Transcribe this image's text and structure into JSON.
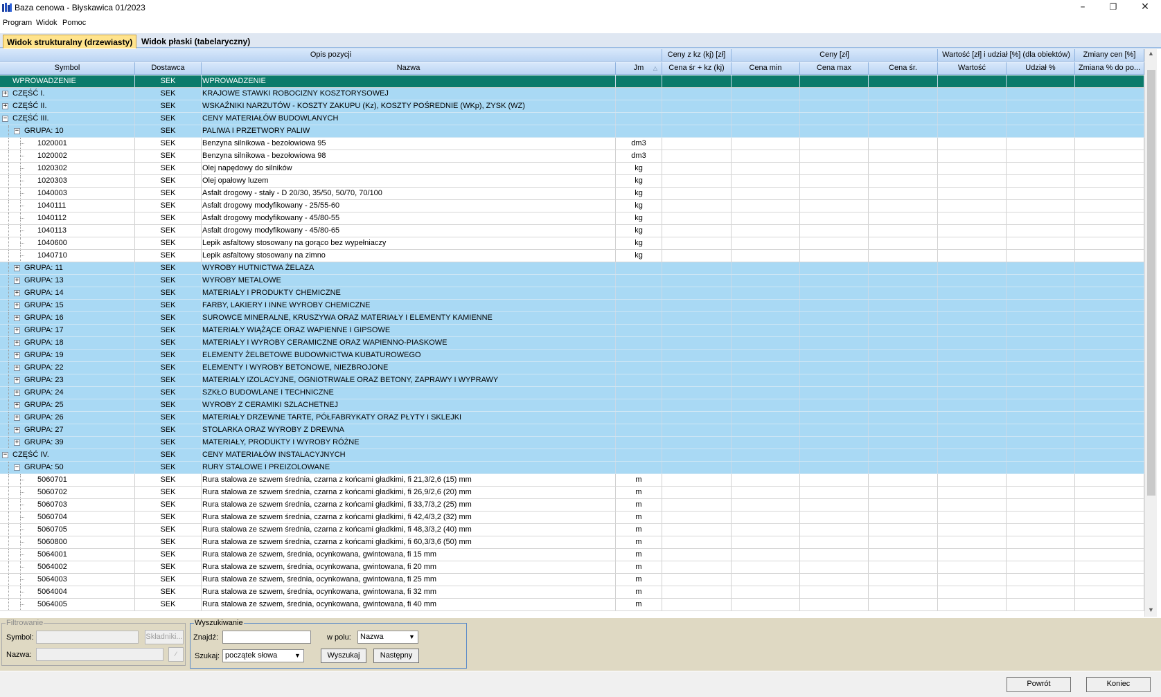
{
  "window": {
    "title": "Baza cenowa - Błyskawica 01/2023",
    "minimize_icon": "minimize-icon",
    "maximize_icon": "maximize-icon",
    "close_icon": "close-icon"
  },
  "menu": [
    "Program",
    "Widok",
    "Pomoc"
  ],
  "tabs": [
    "Widok strukturalny (drzewiasty)",
    "Widok płaski (tabelaryczny)"
  ],
  "header_groups": {
    "opis": "Opis pozycji",
    "kz": "Ceny z kz (kj) [zł]",
    "ceny": "Ceny [zł]",
    "wartosc": "Wartość [zł] i udział [%] (dla obiektów)",
    "zmiany": "Zmiany cen [%]"
  },
  "columns": {
    "symbol": "Symbol",
    "dostawca": "Dostawca",
    "nazwa": "Nazwa",
    "jm": "Jm",
    "cena_kz": "Cena śr + kz (kj)",
    "cena_min": "Cena min",
    "cena_max": "Cena max",
    "cena_sr": "Cena śr.",
    "wartosc": "Wartość",
    "udzial": "Udział %",
    "zmiana": "Zmiana % do po..."
  },
  "rows": [
    {
      "level": 0,
      "type": "selected",
      "exp": "",
      "symbol": "WPROWADZENIE",
      "dostawca": "SEK",
      "nazwa": "WPROWADZENIE",
      "jm": ""
    },
    {
      "level": 0,
      "type": "group",
      "exp": "+",
      "symbol": "CZĘŚĆ I.",
      "dostawca": "SEK",
      "nazwa": "KRAJOWE STAWKI ROBOCIZNY KOSZTORYSOWEJ",
      "jm": ""
    },
    {
      "level": 0,
      "type": "group",
      "exp": "+",
      "symbol": "CZĘŚĆ II.",
      "dostawca": "SEK",
      "nazwa": "WSKAŹNIKI NARZUTÓW - KOSZTY ZAKUPU (Kz), KOSZTY POŚREDNIE (WKp), ZYSK (WZ)",
      "jm": ""
    },
    {
      "level": 0,
      "type": "group",
      "exp": "−",
      "symbol": "CZĘŚĆ III.",
      "dostawca": "SEK",
      "nazwa": "CENY MATERIAŁÓW BUDOWLANYCH",
      "jm": ""
    },
    {
      "level": 1,
      "type": "group",
      "exp": "−",
      "symbol": "GRUPA: 10",
      "dostawca": "SEK",
      "nazwa": "PALIWA I PRZETWORY PALIW",
      "jm": ""
    },
    {
      "level": 2,
      "type": "item",
      "exp": "",
      "symbol": "1020001",
      "dostawca": "SEK",
      "nazwa": "Benzyna silnikowa - bezołowiowa 95",
      "jm": "dm3"
    },
    {
      "level": 2,
      "type": "item",
      "exp": "",
      "symbol": "1020002",
      "dostawca": "SEK",
      "nazwa": "Benzyna silnikowa - bezołowiowa 98",
      "jm": "dm3"
    },
    {
      "level": 2,
      "type": "item",
      "exp": "",
      "symbol": "1020302",
      "dostawca": "SEK",
      "nazwa": "Olej napędowy do silników",
      "jm": "kg"
    },
    {
      "level": 2,
      "type": "item",
      "exp": "",
      "symbol": "1020303",
      "dostawca": "SEK",
      "nazwa": "Olej opałowy luzem",
      "jm": "kg"
    },
    {
      "level": 2,
      "type": "item",
      "exp": "",
      "symbol": "1040003",
      "dostawca": "SEK",
      "nazwa": "Asfalt drogowy - stały - D 20/30, 35/50, 50/70, 70/100",
      "jm": "kg"
    },
    {
      "level": 2,
      "type": "item",
      "exp": "",
      "symbol": "1040111",
      "dostawca": "SEK",
      "nazwa": "Asfalt drogowy modyfikowany - 25/55-60",
      "jm": "kg"
    },
    {
      "level": 2,
      "type": "item",
      "exp": "",
      "symbol": "1040112",
      "dostawca": "SEK",
      "nazwa": "Asfalt drogowy modyfikowany - 45/80-55",
      "jm": "kg"
    },
    {
      "level": 2,
      "type": "item",
      "exp": "",
      "symbol": "1040113",
      "dostawca": "SEK",
      "nazwa": "Asfalt drogowy modyfikowany - 45/80-65",
      "jm": "kg"
    },
    {
      "level": 2,
      "type": "item",
      "exp": "",
      "symbol": "1040600",
      "dostawca": "SEK",
      "nazwa": "Lepik asfaltowy stosowany na gorąco bez wypełniaczy",
      "jm": "kg"
    },
    {
      "level": 2,
      "type": "item",
      "exp": "",
      "symbol": "1040710",
      "dostawca": "SEK",
      "nazwa": "Lepik asfaltowy stosowany na zimno",
      "jm": "kg"
    },
    {
      "level": 1,
      "type": "group",
      "exp": "+",
      "symbol": "GRUPA: 11",
      "dostawca": "SEK",
      "nazwa": "WYROBY HUTNICTWA ŻELAZA",
      "jm": ""
    },
    {
      "level": 1,
      "type": "group",
      "exp": "+",
      "symbol": "GRUPA: 13",
      "dostawca": "SEK",
      "nazwa": "WYROBY METALOWE",
      "jm": ""
    },
    {
      "level": 1,
      "type": "group",
      "exp": "+",
      "symbol": "GRUPA: 14",
      "dostawca": "SEK",
      "nazwa": "MATERIAŁY I PRODUKTY CHEMICZNE",
      "jm": ""
    },
    {
      "level": 1,
      "type": "group",
      "exp": "+",
      "symbol": "GRUPA: 15",
      "dostawca": "SEK",
      "nazwa": "FARBY, LAKIERY I INNE WYROBY CHEMICZNE",
      "jm": ""
    },
    {
      "level": 1,
      "type": "group",
      "exp": "+",
      "symbol": "GRUPA: 16",
      "dostawca": "SEK",
      "nazwa": "SUROWCE MINERALNE, KRUSZYWA ORAZ MATERIAŁY I ELEMENTY KAMIENNE",
      "jm": ""
    },
    {
      "level": 1,
      "type": "group",
      "exp": "+",
      "symbol": "GRUPA: 17",
      "dostawca": "SEK",
      "nazwa": "MATERIAŁY WIĄŻĄCE ORAZ WAPIENNE I GIPSOWE",
      "jm": ""
    },
    {
      "level": 1,
      "type": "group",
      "exp": "+",
      "symbol": "GRUPA: 18",
      "dostawca": "SEK",
      "nazwa": "MATERIAŁY I WYROBY CERAMICZNE ORAZ WAPIENNO-PIASKOWE",
      "jm": ""
    },
    {
      "level": 1,
      "type": "group",
      "exp": "+",
      "symbol": "GRUPA: 19",
      "dostawca": "SEK",
      "nazwa": "ELEMENTY ŻELBETOWE BUDOWNICTWA KUBATUROWEGO",
      "jm": ""
    },
    {
      "level": 1,
      "type": "group",
      "exp": "+",
      "symbol": "GRUPA: 22",
      "dostawca": "SEK",
      "nazwa": "ELEMENTY I WYROBY BETONOWE, NIEZBROJONE",
      "jm": ""
    },
    {
      "level": 1,
      "type": "group",
      "exp": "+",
      "symbol": "GRUPA: 23",
      "dostawca": "SEK",
      "nazwa": "MATERIAŁY IZOLACYJNE, OGNIOTRWAŁE ORAZ BETONY, ZAPRAWY I WYPRAWY",
      "jm": ""
    },
    {
      "level": 1,
      "type": "group",
      "exp": "+",
      "symbol": "GRUPA: 24",
      "dostawca": "SEK",
      "nazwa": "SZKŁO BUDOWLANE I TECHNICZNE",
      "jm": ""
    },
    {
      "level": 1,
      "type": "group",
      "exp": "+",
      "symbol": "GRUPA: 25",
      "dostawca": "SEK",
      "nazwa": "WYROBY Z CERAMIKI SZLACHETNEJ",
      "jm": ""
    },
    {
      "level": 1,
      "type": "group",
      "exp": "+",
      "symbol": "GRUPA: 26",
      "dostawca": "SEK",
      "nazwa": "MATERIAŁY DRZEWNE TARTE, PÓŁFABRYKATY ORAZ PŁYTY I SKLEJKI",
      "jm": ""
    },
    {
      "level": 1,
      "type": "group",
      "exp": "+",
      "symbol": "GRUPA: 27",
      "dostawca": "SEK",
      "nazwa": "STOLARKA ORAZ WYROBY Z DREWNA",
      "jm": ""
    },
    {
      "level": 1,
      "type": "group",
      "exp": "+",
      "symbol": "GRUPA: 39",
      "dostawca": "SEK",
      "nazwa": "MATERIAŁY, PRODUKTY I WYROBY RÓŻNE",
      "jm": ""
    },
    {
      "level": 0,
      "type": "group",
      "exp": "−",
      "symbol": "CZĘŚĆ IV.",
      "dostawca": "SEK",
      "nazwa": "CENY MATERIAŁÓW INSTALACYJNYCH",
      "jm": ""
    },
    {
      "level": 1,
      "type": "group",
      "exp": "−",
      "symbol": "GRUPA: 50",
      "dostawca": "SEK",
      "nazwa": "RURY STALOWE I PREIZOLOWANE",
      "jm": ""
    },
    {
      "level": 2,
      "type": "item",
      "exp": "",
      "symbol": "5060701",
      "dostawca": "SEK",
      "nazwa": "Rura stalowa ze szwem średnia, czarna z końcami gładkimi, fi 21,3/2,6 (15) mm",
      "jm": "m"
    },
    {
      "level": 2,
      "type": "item",
      "exp": "",
      "symbol": "5060702",
      "dostawca": "SEK",
      "nazwa": "Rura stalowa ze szwem średnia, czarna z końcami gładkimi, fi 26,9/2,6 (20) mm",
      "jm": "m"
    },
    {
      "level": 2,
      "type": "item",
      "exp": "",
      "symbol": "5060703",
      "dostawca": "SEK",
      "nazwa": "Rura stalowa ze szwem średnia, czarna z końcami gładkimi, fi 33,7/3,2 (25) mm",
      "jm": "m"
    },
    {
      "level": 2,
      "type": "item",
      "exp": "",
      "symbol": "5060704",
      "dostawca": "SEK",
      "nazwa": "Rura stalowa ze szwem średnia, czarna z końcami gładkimi, fi 42,4/3,2 (32) mm",
      "jm": "m"
    },
    {
      "level": 2,
      "type": "item",
      "exp": "",
      "symbol": "5060705",
      "dostawca": "SEK",
      "nazwa": "Rura stalowa ze szwem średnia, czarna z końcami gładkimi, fi 48,3/3,2 (40) mm",
      "jm": "m"
    },
    {
      "level": 2,
      "type": "item",
      "exp": "",
      "symbol": "5060800",
      "dostawca": "SEK",
      "nazwa": "Rura stalowa ze szwem średnia, czarna z końcami gładkimi, fi 60,3/3,6 (50) mm",
      "jm": "m"
    },
    {
      "level": 2,
      "type": "item",
      "exp": "",
      "symbol": "5064001",
      "dostawca": "SEK",
      "nazwa": "Rura stalowa ze szwem, średnia, ocynkowana, gwintowana, fi 15 mm",
      "jm": "m"
    },
    {
      "level": 2,
      "type": "item",
      "exp": "",
      "symbol": "5064002",
      "dostawca": "SEK",
      "nazwa": "Rura stalowa ze szwem, średnia, ocynkowana, gwintowana, fi 20 mm",
      "jm": "m"
    },
    {
      "level": 2,
      "type": "item",
      "exp": "",
      "symbol": "5064003",
      "dostawca": "SEK",
      "nazwa": "Rura stalowa ze szwem, średnia, ocynkowana, gwintowana, fi 25 mm",
      "jm": "m"
    },
    {
      "level": 2,
      "type": "item",
      "exp": "",
      "symbol": "5064004",
      "dostawca": "SEK",
      "nazwa": "Rura stalowa ze szwem, średnia, ocynkowana, gwintowana, fi 32 mm",
      "jm": "m"
    },
    {
      "level": 2,
      "type": "item",
      "exp": "",
      "symbol": "5064005",
      "dostawca": "SEK",
      "nazwa": "Rura stalowa ze szwem, średnia, ocynkowana, gwintowana, fi 40 mm",
      "jm": "m"
    }
  ],
  "filter": {
    "legend": "Filtrowanie",
    "symbol_label": "Symbol:",
    "nazwa_label": "Nazwa:",
    "skladniki_button": "Składniki..."
  },
  "search": {
    "legend": "Wyszukiwanie",
    "znajdz_label": "Znajdź:",
    "znajdz_value": "",
    "w_polu_label": "w polu:",
    "w_polu_value": "Nazwa",
    "szukaj_label": "Szukaj:",
    "szukaj_value": "początek słowa",
    "wyszukaj_button": "Wyszukaj",
    "nastepny_button": "Następny"
  },
  "footer": {
    "powrot_button": "Powrót",
    "koniec_button": "Koniec"
  },
  "colors": {
    "group_row": "#a9d9f4",
    "selected_row": "#0b7a6a",
    "header": "#bcd5f3",
    "panel": "#dfd9c3",
    "active_tab": "#ffe38c"
  }
}
